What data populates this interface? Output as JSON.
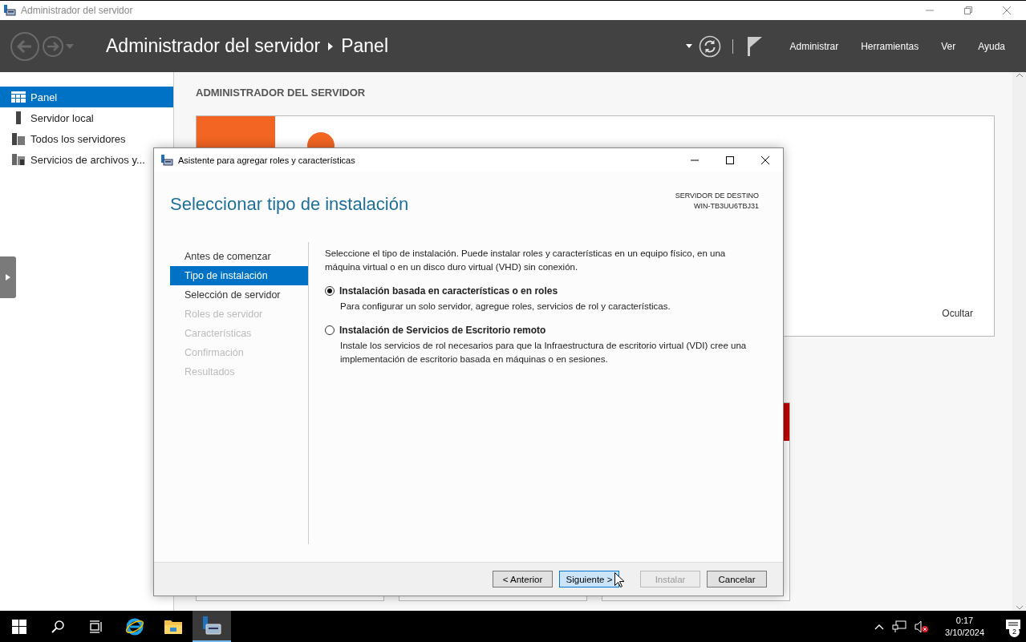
{
  "window": {
    "title": "Administrador del servidor"
  },
  "header": {
    "breadcrumb": [
      "Administrador del servidor",
      "Panel"
    ],
    "menu": [
      "Administrar",
      "Herramientas",
      "Ver",
      "Ayuda"
    ]
  },
  "sidebar": {
    "items": [
      {
        "label": "Panel",
        "kind": "dashboard",
        "selected": true
      },
      {
        "label": "Servidor local",
        "kind": "server",
        "selected": false
      },
      {
        "label": "Todos los servidores",
        "kind": "servers",
        "selected": false
      },
      {
        "label": "Servicios de archivos y...",
        "kind": "files",
        "selected": false
      }
    ]
  },
  "main": {
    "heading": "ADMINISTRADOR DEL SERVIDOR",
    "welcome": {
      "hide_link": "Ocultar"
    },
    "tiles": {
      "last_alert": true
    }
  },
  "dialog": {
    "title": "Asistente para agregar roles y características",
    "page_title": "Seleccionar tipo de instalación",
    "destination_label": "SERVIDOR DE DESTINO",
    "destination_server": "WIN-TB3UU6TBJ31",
    "steps": [
      {
        "label": "Antes de comenzar",
        "selected": false,
        "disabled": false
      },
      {
        "label": "Tipo de instalación",
        "selected": true,
        "disabled": false
      },
      {
        "label": "Selección de servidor",
        "selected": false,
        "disabled": false
      },
      {
        "label": "Roles de servidor",
        "selected": false,
        "disabled": true
      },
      {
        "label": "Características",
        "selected": false,
        "disabled": true
      },
      {
        "label": "Confirmación",
        "selected": false,
        "disabled": true
      },
      {
        "label": "Resultados",
        "selected": false,
        "disabled": true
      }
    ],
    "intro": "Seleccione el tipo de instalación. Puede instalar roles y características en un equipo físico, en una máquina virtual o en un disco duro virtual (VHD) sin conexión.",
    "options": [
      {
        "label": "Instalación basada en características o en roles",
        "description": "Para configurar un solo servidor, agregue roles, servicios de rol y características.",
        "selected": true
      },
      {
        "label": "Instalación de Servicios de Escritorio remoto",
        "description": "Instale los servicios de rol necesarios para que la Infraestructura de escritorio virtual (VDI) cree una implementación de escritorio basada en máquinas o en sesiones.",
        "selected": false
      }
    ],
    "buttons": [
      {
        "label": "< Anterior",
        "disabled": false,
        "highlighted": false
      },
      {
        "label": "Siguiente >",
        "disabled": false,
        "highlighted": true
      },
      {
        "label": "Instalar",
        "disabled": true,
        "highlighted": false
      },
      {
        "label": "Cancelar",
        "disabled": false,
        "highlighted": false
      }
    ]
  },
  "taskbar": {
    "apps": [
      {
        "kind": "start",
        "selected": false
      },
      {
        "kind": "search",
        "selected": false
      },
      {
        "kind": "taskview",
        "selected": false
      },
      {
        "kind": "browser",
        "selected": false
      },
      {
        "kind": "folder",
        "selected": false
      },
      {
        "kind": "servermanager",
        "selected": true
      }
    ],
    "clock": {
      "time": "0:17",
      "date": "3/10/2024"
    },
    "notifications": {
      "count": "2"
    }
  }
}
